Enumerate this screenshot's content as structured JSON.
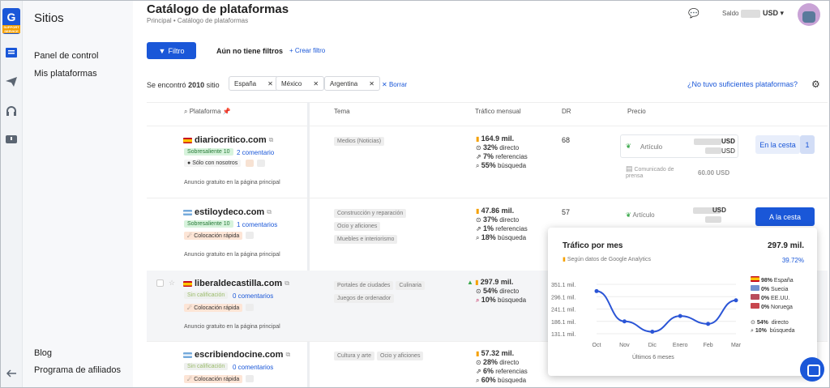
{
  "app": {
    "logo_text": "G",
    "logo_sub": "SUPPORT SERVICE",
    "accent": "#1a57d8"
  },
  "sidebar": {
    "title": "Sitios",
    "items": [
      {
        "label": "Panel de control"
      },
      {
        "label": "Mis plataformas"
      }
    ],
    "bottom_items": [
      {
        "label": "Blog"
      },
      {
        "label": "Programa de afiliados"
      }
    ]
  },
  "header": {
    "title": "Catálogo de plataformas",
    "breadcrumb": "Principal  •  Catálogo de plataformas",
    "saldo_label": "Saldo",
    "currency": "USD"
  },
  "filters": {
    "button": "Filtro",
    "no_filters": "Aún no tiene filtros",
    "create": "+ Crear filtro",
    "found_prefix": "Se encontró",
    "found_count": "2010",
    "found_suffix": "sitio",
    "chips": [
      "España",
      "México",
      "Argentina"
    ],
    "clear": "Borrar",
    "not_enough": "¿No tuvo suficientes plataformas?"
  },
  "table": {
    "headers": {
      "platform": "Plataforma",
      "topic": "Tema",
      "traffic": "Tráfico mensual",
      "dr": "DR",
      "price": "Precio"
    },
    "rows": [
      {
        "name": "diariocritico.com",
        "flag": "es",
        "badge": "Sobresaliente 10",
        "comments": "2 comentario",
        "extra_badge": "Sólo con nosotros",
        "announce": "Anuncio gratuito en la página principal",
        "tags": [
          "Medios (Noticias)"
        ],
        "traffic": "164.9 mil.",
        "t1": "32%",
        "t1l": "directo",
        "t2": "7%",
        "t2l": "referencias",
        "t3": "55%",
        "t3l": "búsqueda",
        "dr": "68",
        "price_type": "Artículo",
        "price_currency": "USD",
        "press_label": "Comunicado de prensa",
        "press_price": "60.00 USD",
        "button": "En la cesta",
        "count": "1"
      },
      {
        "name": "estiloydeco.com",
        "flag": "ar",
        "badge": "Sobresaliente 10",
        "comments": "1 comentarios",
        "extra_badge": "Colocación rápida",
        "announce": "Anuncio gratuito en la página principal",
        "tags": [
          "Construcción y reparación",
          "Ocio y aficiones",
          "Muebles e interiorismo"
        ],
        "traffic": "47.86 mil.",
        "t1": "37%",
        "t1l": "directo",
        "t2": "1%",
        "t2l": "referencias",
        "t3": "18%",
        "t3l": "búsqueda",
        "dr": "57",
        "price_type": "Artículo",
        "price_currency": "USD",
        "button": "A la cesta"
      },
      {
        "name": "liberaldecastilla.com",
        "flag": "es",
        "badge": "Sin calificación",
        "comments": "0 comentarios",
        "extra_badge": "Colocación rápida",
        "announce": "Anuncio gratuito en la página principal",
        "tags": [
          "Portales de ciudades",
          "Culinaria",
          "Juegos de ordenador"
        ],
        "traffic": "297.9 mil.",
        "t1": "54%",
        "t1l": "directo",
        "t3": "10%",
        "t3l": "búsqueda"
      },
      {
        "name": "escribiendocine.com",
        "flag": "ar",
        "badge": "Sin calificación",
        "comments": "0 comentarios",
        "extra_badge": "Colocación rápida",
        "tags": [
          "Cultura y arte",
          "Ocio y aficiones"
        ],
        "traffic": "57.32 mil.",
        "t1": "28%",
        "t1l": "directo",
        "t2": "6%",
        "t2l": "referencias",
        "t3": "60%",
        "t3l": "búsqueda"
      }
    ]
  },
  "popup": {
    "title": "Tráfico por mes",
    "total": "297.9 mil.",
    "source": "Según datos de Google Analytics",
    "change": "39.72%",
    "footer": "Últimos 6 meses",
    "countries": [
      {
        "pct": "98%",
        "name": "España"
      },
      {
        "pct": "0%",
        "name": "Suecia"
      },
      {
        "pct": "0%",
        "name": "EE.UU."
      },
      {
        "pct": "0%",
        "name": "Noruega"
      }
    ],
    "sources": [
      {
        "pct": "54%",
        "name": "directo"
      },
      {
        "pct": "10%",
        "name": "búsqueda"
      }
    ]
  },
  "chart_data": {
    "type": "line",
    "x": [
      "Oct",
      "Nov",
      "Dic",
      "Enero",
      "Feb",
      "Mar"
    ],
    "y_ticks": [
      "351.1 mil.",
      "296.1 mil.",
      "241.1 mil.",
      "186.1 mil.",
      "131.1 mil."
    ],
    "ylim": [
      131.1,
      351.1
    ],
    "values": [
      321,
      186,
      140,
      210,
      175,
      280
    ],
    "color": "#2b55d6"
  }
}
